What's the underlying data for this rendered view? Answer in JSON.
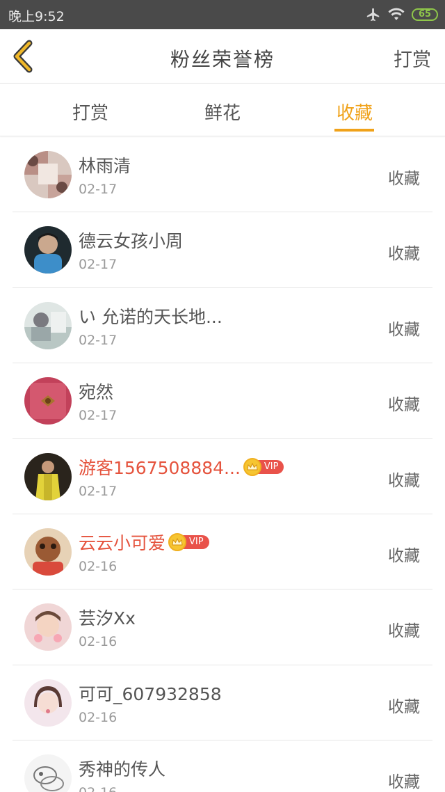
{
  "status_bar": {
    "time": "晚上9:52",
    "battery": "65"
  },
  "header": {
    "title": "粉丝荣誉榜",
    "action": "打赏"
  },
  "tabs": [
    {
      "label": "打赏",
      "active": false
    },
    {
      "label": "鲜花",
      "active": false
    },
    {
      "label": "收藏",
      "active": true
    }
  ],
  "colors": {
    "accent": "#f0a21a",
    "vip_name": "#e5533d",
    "vip_tag": "#e9524a",
    "crown": "#f6c531"
  },
  "fans": [
    {
      "name": "林雨清",
      "date": "02-17",
      "action": "收藏",
      "vip": false
    },
    {
      "name": "德云女孩小周",
      "date": "02-17",
      "action": "收藏",
      "vip": false
    },
    {
      "name": "い 允诺的天长地...",
      "date": "02-17",
      "action": "收藏",
      "vip": false
    },
    {
      "name": "宛然",
      "date": "02-17",
      "action": "收藏",
      "vip": false
    },
    {
      "name": "游客1567508884...",
      "date": "02-17",
      "action": "收藏",
      "vip": true,
      "vip_label": "VIP"
    },
    {
      "name": "云云小可爱",
      "date": "02-16",
      "action": "收藏",
      "vip": true,
      "vip_label": "VIP"
    },
    {
      "name": "芸汐Xx",
      "date": "02-16",
      "action": "收藏",
      "vip": false
    },
    {
      "name": "可可_607932858",
      "date": "02-16",
      "action": "收藏",
      "vip": false
    },
    {
      "name": "秀神的传人",
      "date": "02-16",
      "action": "收藏",
      "vip": false
    }
  ]
}
